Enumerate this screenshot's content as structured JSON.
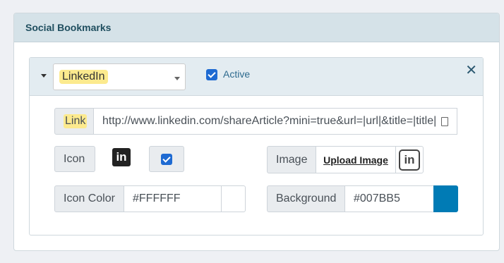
{
  "panel": {
    "title": "Social Bookmarks"
  },
  "bookmark": {
    "network_select": {
      "value": "LinkedIn"
    },
    "active": {
      "label": "Active",
      "checked": true
    },
    "close_label": "✕",
    "link": {
      "label": "Link",
      "value": "http://www.linkedin.com/shareArticle?mini=true&url=|url|&title=|title|"
    },
    "icon": {
      "label": "Icon",
      "glyph": "in",
      "use_checked": true
    },
    "image": {
      "label": "Image",
      "upload_label": "Upload Image",
      "preview_glyph": "in"
    },
    "icon_color": {
      "label": "Icon Color",
      "value": "#FFFFFF",
      "swatch": "#FFFFFF"
    },
    "background": {
      "label": "Background",
      "value": "#007BB5",
      "swatch": "#007BB5"
    }
  },
  "colors": {
    "accent": "#1e6ad2",
    "highlight": "#fcea8e",
    "header_bg": "#d5e2e8"
  }
}
